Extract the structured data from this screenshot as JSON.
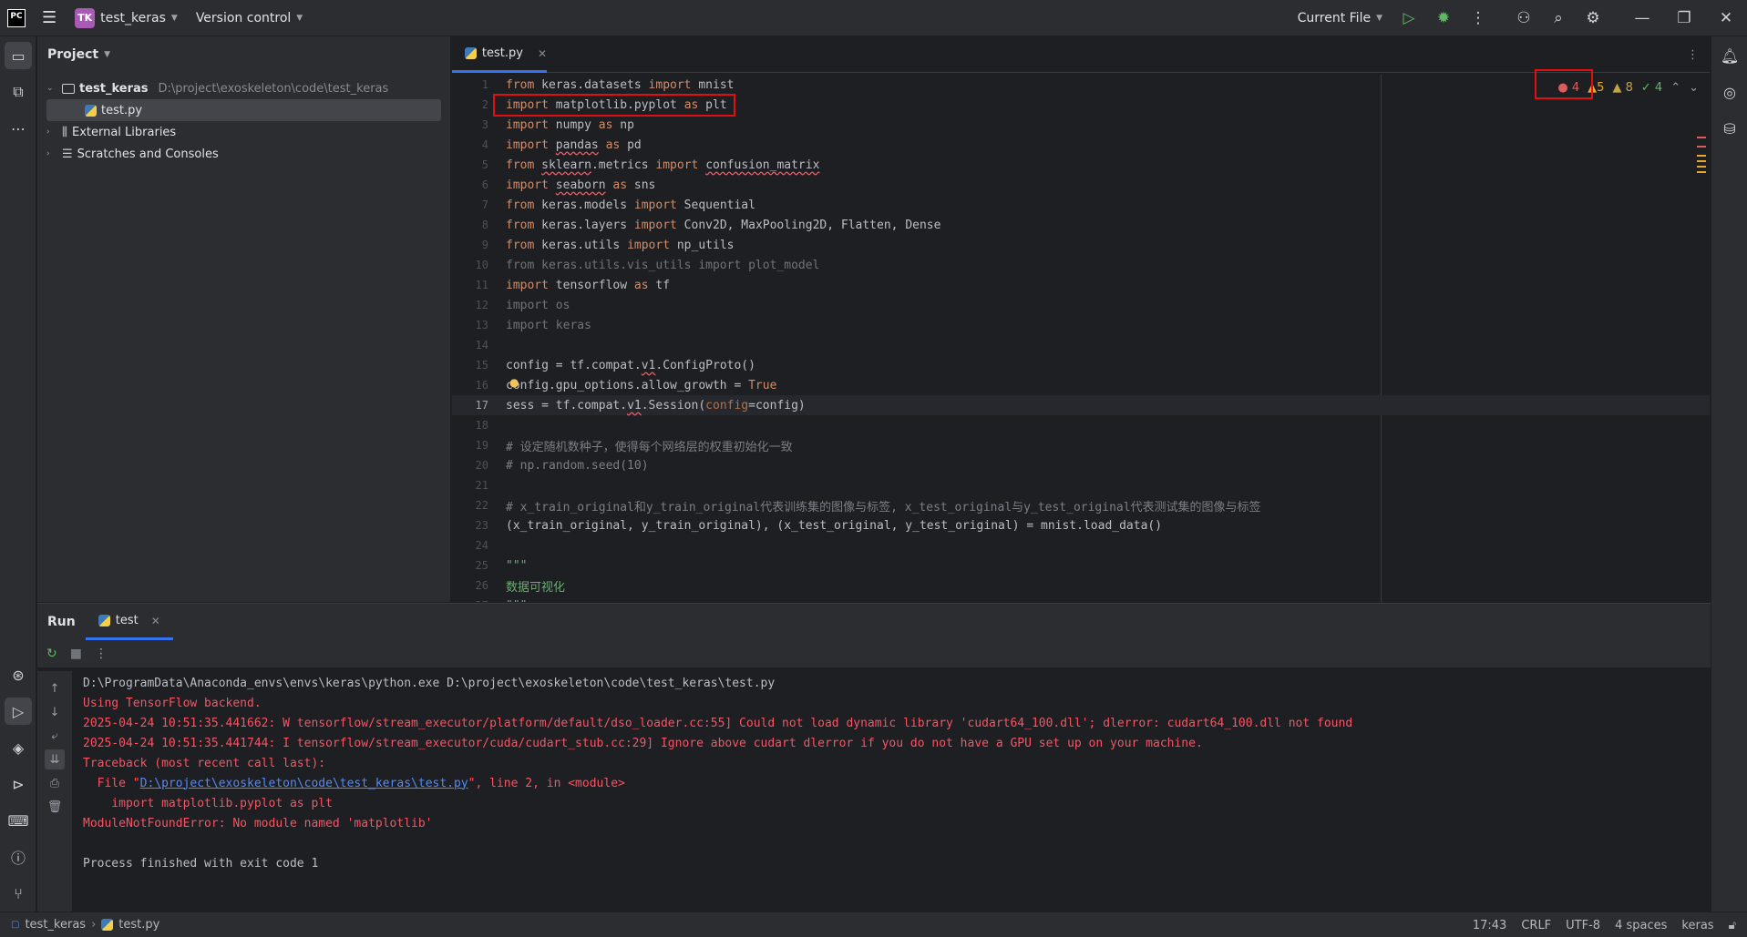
{
  "titlebar": {
    "logo": "PC",
    "project_badge": "TK",
    "project_name": "test_keras",
    "vcs": "Version control",
    "run_config": "Current File"
  },
  "icons": {
    "menu": "hamburger-icon",
    "run": "play-icon",
    "debug": "bug-icon",
    "more": "kebab-icon",
    "add_user": "add-user-icon",
    "search": "search-icon",
    "settings": "gear-icon"
  },
  "project_panel": {
    "title": "Project",
    "tree": [
      {
        "label": "test_keras",
        "path": "D:\\project\\exoskeleton\\code\\test_keras"
      },
      {
        "label": "test.py"
      },
      {
        "label": "External Libraries"
      },
      {
        "label": "Scratches and Consoles"
      }
    ]
  },
  "editor": {
    "tab": "test.py",
    "inspections": {
      "errors": "4",
      "warnings": "5",
      "weak_warnings": "8",
      "ok": "4"
    },
    "current_line": 17
  },
  "run_panel": {
    "title": "Run",
    "tab": "test",
    "console": [
      "D:\\ProgramData\\Anaconda_envs\\envs\\keras\\python.exe D:\\project\\exoskeleton\\code\\test_keras\\test.py",
      "Using TensorFlow backend.",
      "2025-04-24 10:51:35.441662: W tensorflow/stream_executor/platform/default/dso_loader.cc:55] Could not load dynamic library 'cudart64_100.dll'; dlerror: cudart64_100.dll not found",
      "2025-04-24 10:51:35.441744: I tensorflow/stream_executor/cuda/cudart_stub.cc:29] Ignore above cudart dlerror if you do not have a GPU set up on your machine.",
      "Traceback (most recent call last):",
      "  File \"",
      "D:\\project\\exoskeleton\\code\\test_keras\\test.py",
      "\", line 2, in <module>",
      "    import matplotlib.pyplot as plt",
      "ModuleNotFoundError: No module named 'matplotlib'",
      "Process finished with exit code 1"
    ]
  },
  "statusbar": {
    "project": "test_keras",
    "file": "test.py",
    "position": "17:43",
    "line_sep": "CRLF",
    "encoding": "UTF-8",
    "indent": "4 spaces",
    "interpreter": "keras"
  },
  "colors": {
    "background": "#1e1f22",
    "panel": "#2b2d30",
    "accent": "#3574f0",
    "error": "#f75464",
    "highlight_box": "#e01010"
  }
}
